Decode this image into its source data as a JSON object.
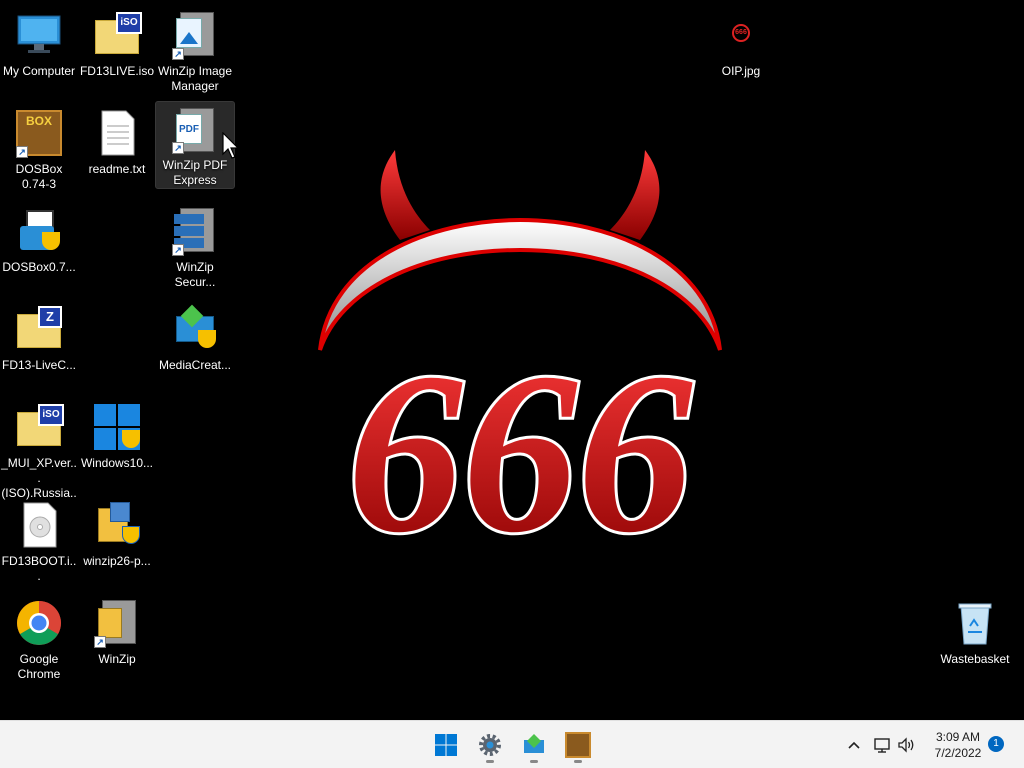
{
  "desktop": {
    "icons": {
      "my_computer": "My Computer",
      "fd13live": "FD13LIVE.iso",
      "winzip_image": "WinZip Image\nManager",
      "oip": "OIP.jpg",
      "dosbox_074": "DOSBox\n0.74-3",
      "readme": "readme.txt",
      "winzip_pdf": "WinZip PDF\nExpress",
      "dosbox07": "DOSBox0.7...",
      "winzip_secure": "WinZip\nSecur...",
      "fd13_livec": "FD13-LiveC...",
      "mediacreat": "MediaCreat...",
      "mui_xp": "_MUI_XP.ver...\n(ISO).Russia...",
      "windows10": "Windows10...",
      "fd13boot": "FD13BOOT.i...",
      "winzip26": "winzip26-p...",
      "chrome": "Google\nChrome",
      "winzip": "WinZip",
      "wastebasket": "Wastebasket"
    },
    "wallpaper_text": "666",
    "iso_badge": "iSO",
    "pdf_badge": "PDF",
    "dosbox_badge": "BOX",
    "z_badge": "Z"
  },
  "taskbar": {
    "clock_time": "3:09 AM",
    "clock_date": "7/2/2022",
    "notification_count": "1"
  },
  "colors": {
    "accent": "#0067c0",
    "wallpaper_red": "#d6141a",
    "taskbar_bg": "#f3f3f3"
  }
}
